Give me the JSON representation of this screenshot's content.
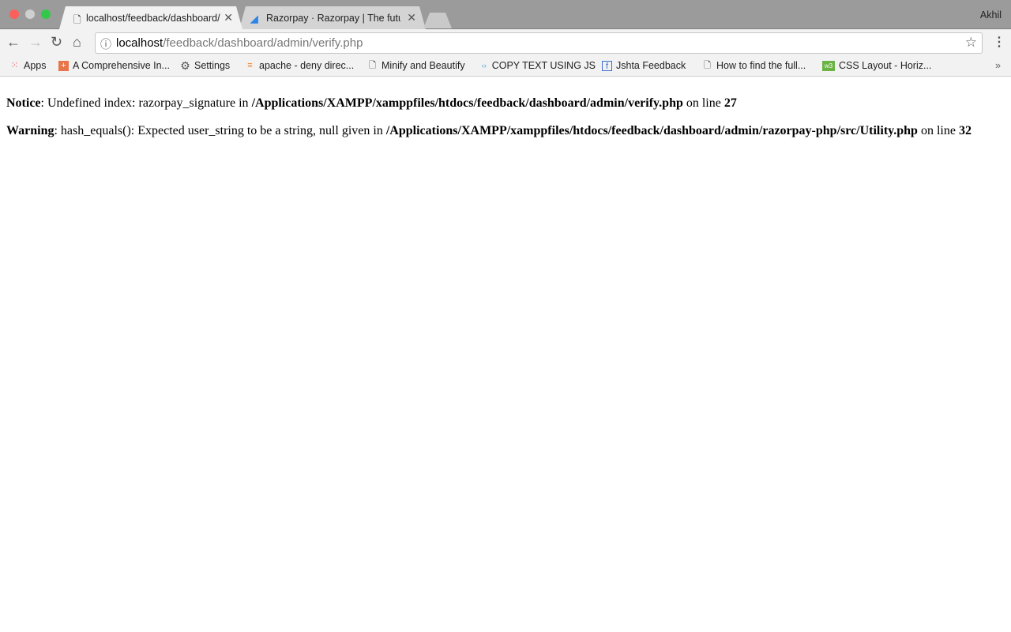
{
  "browser": {
    "profile": "Akhil",
    "tabs": [
      {
        "title": "localhost/feedback/dashboard/admin/verify.php",
        "active": true
      },
      {
        "title": "Razorpay · Razorpay | The future of payments"
      }
    ],
    "url_host": "localhost",
    "url_path": "/feedback/dashboard/admin/verify.php",
    "bookmarks": [
      {
        "label": "Apps",
        "icon": "apps-grid-icon"
      },
      {
        "label": "A Comprehensive In...",
        "icon": "plus-icon"
      },
      {
        "label": "Settings",
        "icon": "gear-icon"
      },
      {
        "label": "apache - deny direc...",
        "icon": "stackoverflow-icon"
      },
      {
        "label": "Minify and Beautify",
        "icon": "page-icon"
      },
      {
        "label": "COPY TEXT USING JS",
        "icon": "code-icon"
      },
      {
        "label": "Jshta Feedback",
        "icon": "facebook-icon"
      },
      {
        "label": "How to find the full...",
        "icon": "page-icon"
      },
      {
        "label": "CSS Layout - Horiz...",
        "icon": "w3schools-icon"
      }
    ]
  },
  "messages": [
    {
      "level": "Notice",
      "text": ": Undefined index: razorpay_signature in ",
      "file": "/Applications/XAMPP/xamppfiles/htdocs/feedback/dashboard/admin/verify.php",
      "on": " on line ",
      "line": "27"
    },
    {
      "level": "Warning",
      "text": ": hash_equals(): Expected user_string to be a string, null given in ",
      "file": "/Applications/XAMPP/xamppfiles/htdocs/feedback/dashboard/admin/razorpay-php/src/Utility.php",
      "on": " on line ",
      "line": "32"
    }
  ]
}
